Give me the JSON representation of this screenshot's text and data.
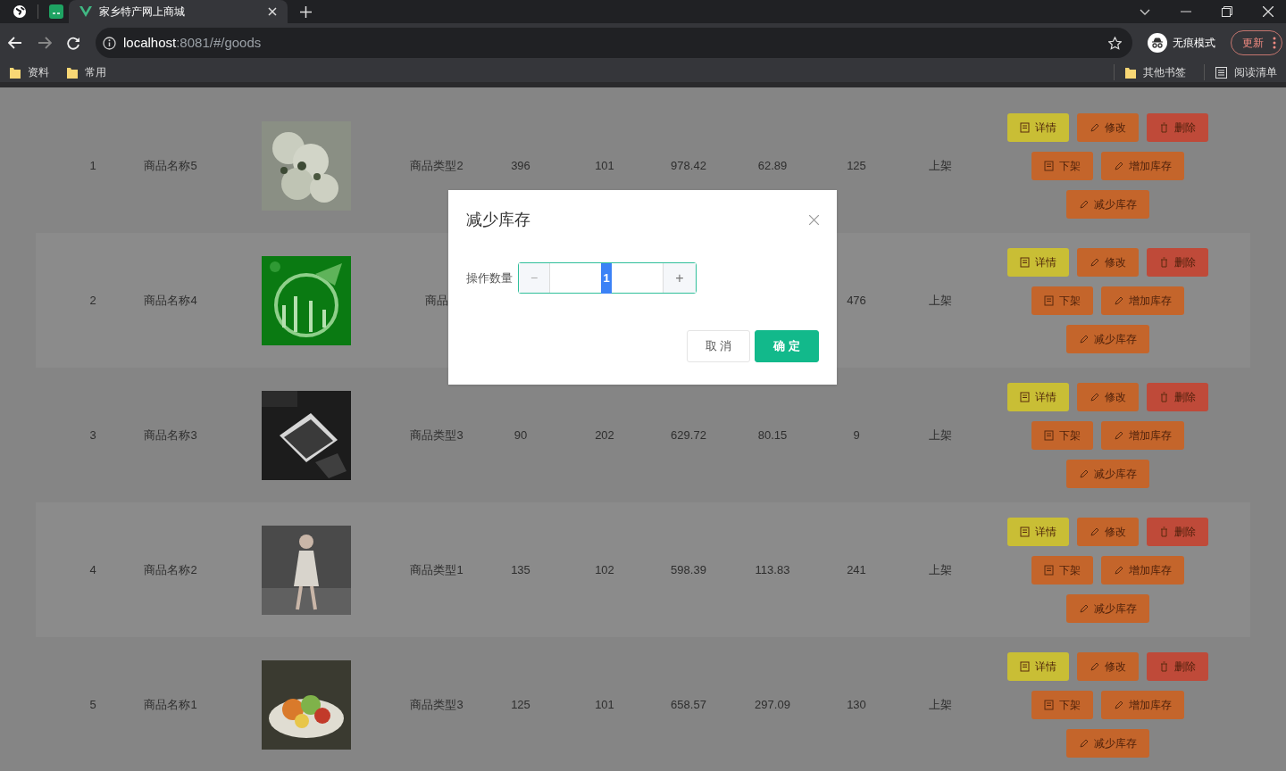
{
  "browser": {
    "tabs": [
      {
        "title": "家乡特产网上商城",
        "selected": true
      }
    ],
    "url": {
      "host": "localhost",
      "rest": ":8081/#/goods"
    },
    "profile": "无痕模式",
    "update": "更新",
    "bookmarks": [
      "资料",
      "常用"
    ],
    "bookmarks_right": [
      {
        "label": "其他书签",
        "kind": "folder"
      },
      {
        "label": "阅读清单",
        "kind": "list"
      }
    ]
  },
  "table": {
    "rows": [
      {
        "cells_before": [
          "1",
          "商品名称5"
        ],
        "cells": {
          "type": "商品类型2",
          "column_5": "396",
          "column_6": "101",
          "column_7": "978.42",
          "column_8": "62.89",
          "column_9": "125",
          "status": "上架"
        },
        "actions": [
          {
            "label": "详情",
            "kind": "detail"
          },
          {
            "label": "修改",
            "kind": "edit"
          },
          {
            "label": "删除",
            "kind": "delete"
          },
          {
            "label": "下架",
            "kind": "offshelf"
          },
          {
            "label": "增加库存",
            "kind": "add"
          },
          {
            "label": "减少库存",
            "kind": "reduce"
          }
        ]
      },
      {
        "cells_before": [
          "2",
          "商品名称4"
        ],
        "cells": {
          "type": "商品",
          "column_9": "476",
          "status": "上架"
        },
        "actions": [
          {
            "label": "详情",
            "kind": "detail"
          },
          {
            "label": "修改",
            "kind": "edit"
          },
          {
            "label": "删除",
            "kind": "delete"
          },
          {
            "label": "下架",
            "kind": "offshelf"
          },
          {
            "label": "增加库存",
            "kind": "add"
          },
          {
            "label": "减少库存",
            "kind": "reduce"
          }
        ]
      },
      {
        "cells_before": [
          "3",
          "商品名称3"
        ],
        "cells": {
          "type": "商品类型3",
          "column_5": "90",
          "column_6": "202",
          "column_7": "629.72",
          "column_8": "80.15",
          "column_9": "9",
          "status": "上架"
        },
        "actions": [
          {
            "label": "详情",
            "kind": "detail"
          },
          {
            "label": "修改",
            "kind": "edit"
          },
          {
            "label": "删除",
            "kind": "delete"
          },
          {
            "label": "下架",
            "kind": "offshelf"
          },
          {
            "label": "增加库存",
            "kind": "add"
          },
          {
            "label": "减少库存",
            "kind": "reduce"
          }
        ]
      },
      {
        "cells_before": [
          "4",
          "商品名称2"
        ],
        "cells": {
          "type": "商品类型1",
          "column_5": "135",
          "column_6": "102",
          "column_7": "598.39",
          "column_8": "113.83",
          "column_9": "241",
          "status": "上架"
        },
        "actions": [
          {
            "label": "详情",
            "kind": "detail"
          },
          {
            "label": "修改",
            "kind": "edit"
          },
          {
            "label": "删除",
            "kind": "delete"
          },
          {
            "label": "下架",
            "kind": "offshelf"
          },
          {
            "label": "增加库存",
            "kind": "add"
          },
          {
            "label": "减少库存",
            "kind": "reduce"
          }
        ]
      },
      {
        "cells_before": [
          "5",
          "商品名称1"
        ],
        "cells": {
          "type": "商品类型3",
          "column_5": "125",
          "column_6": "101",
          "column_7": "658.57",
          "column_8": "297.09",
          "column_9": "130",
          "status": "上架"
        },
        "actions": [
          {
            "label": "详情",
            "kind": "detail"
          },
          {
            "label": "修改",
            "kind": "edit"
          },
          {
            "label": "删除",
            "kind": "delete"
          },
          {
            "label": "下架",
            "kind": "offshelf"
          },
          {
            "label": "增加库存",
            "kind": "add"
          },
          {
            "label": "减少库存",
            "kind": "reduce"
          }
        ]
      }
    ]
  },
  "dialog": {
    "title": "减少库存",
    "field_label": "操作数量",
    "value": "1",
    "minus": "−",
    "plus": "+",
    "buttons": [
      {
        "label": "取 消",
        "kind": "default"
      },
      {
        "label": "确 定",
        "kind": "primary"
      }
    ]
  }
}
